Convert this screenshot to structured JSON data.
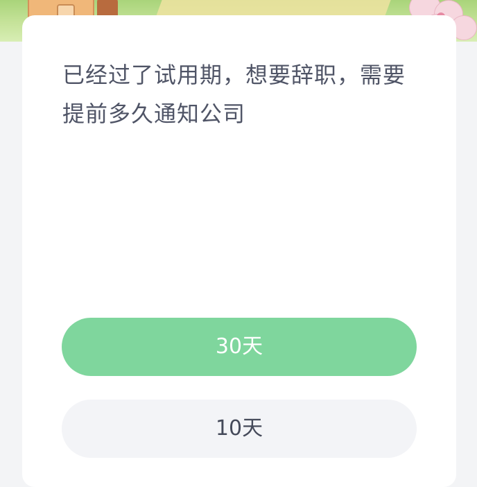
{
  "question": {
    "text": "已经过了试用期，想要辞职，需要提前多久通知公司"
  },
  "options": [
    {
      "label": "30天",
      "state": "selected"
    },
    {
      "label": "10天",
      "state": "default"
    }
  ],
  "colors": {
    "selected_option_bg": "#7fd69d",
    "default_option_bg": "#f3f4f7",
    "question_text": "#4f5466"
  }
}
